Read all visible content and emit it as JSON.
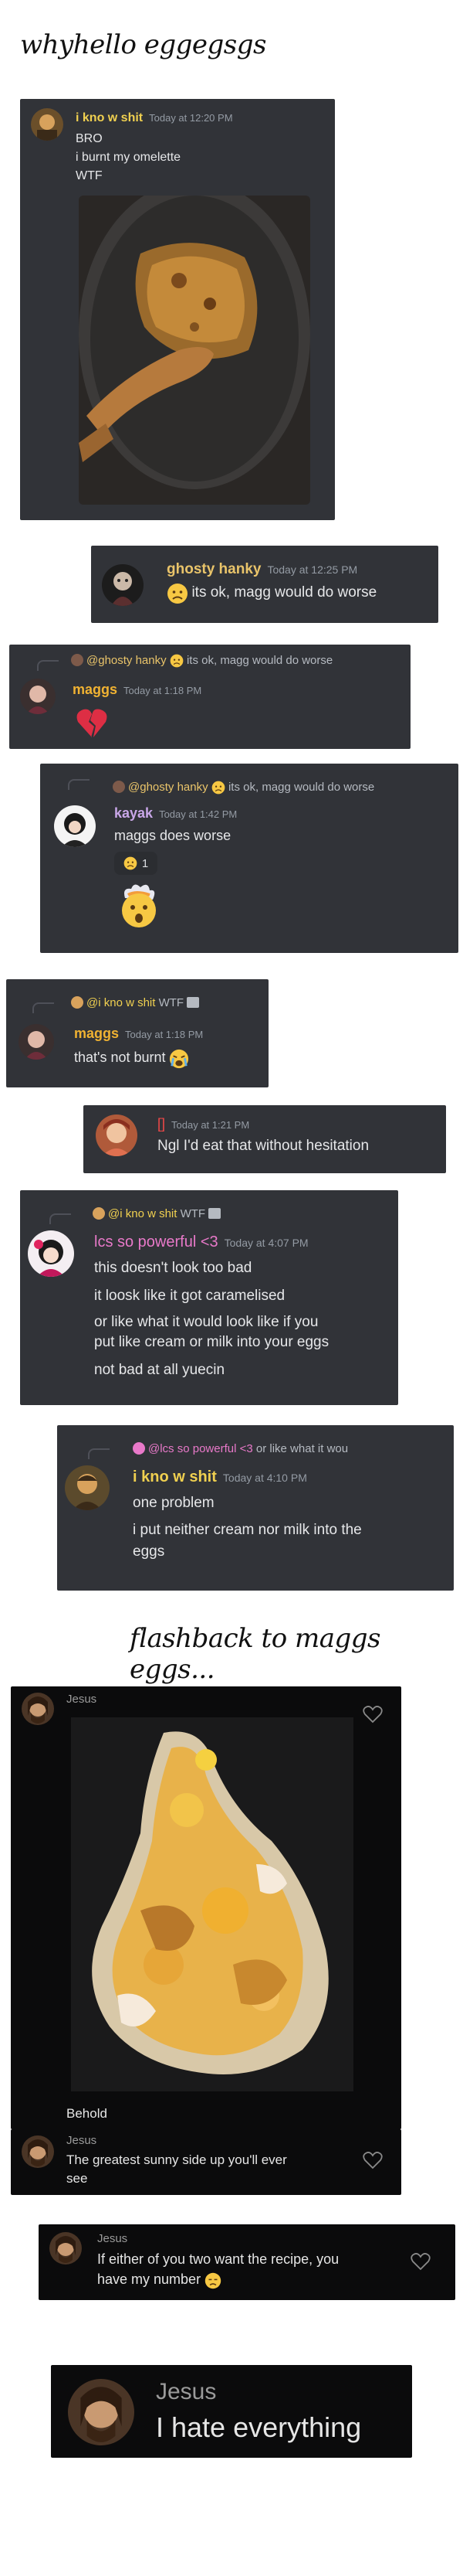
{
  "title": "whyhello eggegsgs",
  "flashback_title": "flashback to maggs eggs...",
  "colors": {
    "discord_bg": "#313338",
    "dark_bg": "#0b0b0c",
    "timestamp": "#949ba4",
    "maggs": "#f0b232",
    "ghosty": "#e9c46a",
    "kayak": "#c9a7e8",
    "iknow": "#f0d050",
    "lcs": "#e879c9",
    "red_heart": "#dd2e44"
  },
  "msg1": {
    "author": "i kno w shit",
    "time": "Today at 12:20 PM",
    "lines": [
      "BRO",
      "i burnt my omelette",
      "WTF"
    ],
    "attachment": "burnt-omelette-photo"
  },
  "msg2": {
    "author": "ghosty hanky",
    "time": "Today at 12:25 PM",
    "text": "its ok, magg would do worse",
    "emoji": "worried-face-emoji"
  },
  "msg3": {
    "reply_to": "@ghosty hanky",
    "reply_text": "its ok, magg would do worse",
    "author": "maggs",
    "time": "Today at 1:18 PM",
    "emoji": "broken-heart-emoji"
  },
  "msg4": {
    "reply_to": "@ghosty hanky",
    "reply_text": "its ok, magg would do worse",
    "author": "kayak",
    "time": "Today at 1:42 PM",
    "text": "maggs does worse",
    "reaction_count": "1",
    "emoji": "exploding-head-emoji"
  },
  "msg5": {
    "reply_to": "@i kno w shit",
    "reply_text": "WTF",
    "author": "maggs",
    "time": "Today at 1:18 PM",
    "text": "that's not burnt",
    "emoji": "crying-face-emoji"
  },
  "msg6": {
    "author": "[]",
    "time": "Today at 1:21 PM",
    "text": "Ngl I'd eat that without hesitation"
  },
  "msg7": {
    "reply_to": "@i kno w shit",
    "reply_text": "WTF",
    "author": "lcs so powerful <3",
    "time": "Today at 4:07 PM",
    "lines": [
      "this doesn't look too bad",
      "it loosk like it got caramelised",
      "or like what it would look like if you",
      "put like cream or milk into your eggs",
      "not bad at all yuecin"
    ]
  },
  "msg8": {
    "reply_to": "@lcs so powerful <3",
    "reply_text": "or like what it wou",
    "author": "i kno w shit",
    "time": "Today at 4:10 PM",
    "lines": [
      "one problem",
      "i put neither cream nor milk into the",
      "eggs"
    ]
  },
  "jesus1": {
    "author": "Jesus",
    "caption": "Behold",
    "attachment": "egg-photo"
  },
  "jesus2": {
    "author": "Jesus",
    "lines": [
      "The greatest sunny side up you'll ever",
      "see"
    ]
  },
  "jesus3": {
    "author": "Jesus",
    "lines": [
      "If either of you two want the recipe, you",
      "have my number"
    ],
    "emoji": "sad-face-emoji"
  },
  "jesus4": {
    "author": "Jesus",
    "text": "I hate everything"
  }
}
